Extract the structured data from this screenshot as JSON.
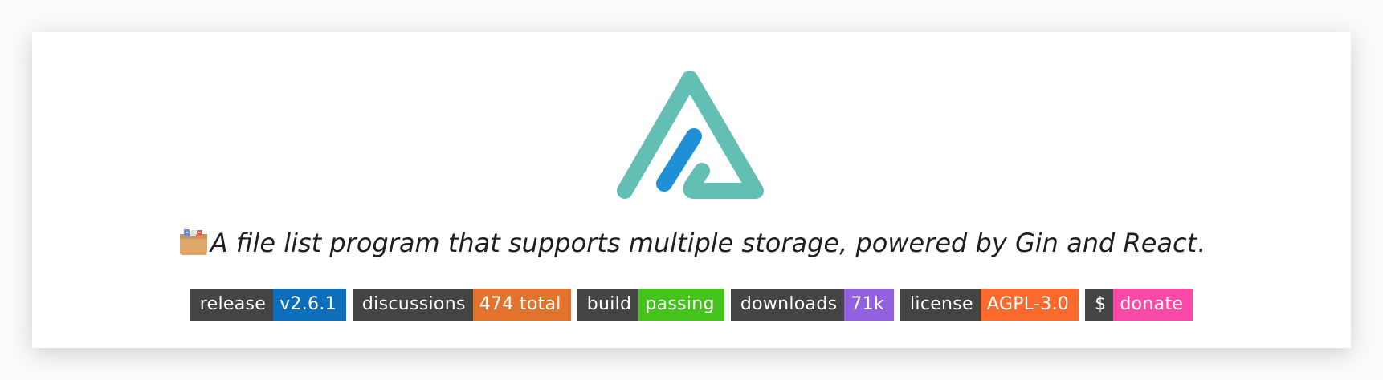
{
  "tagline": {
    "icon": "file-box-icon",
    "text": "A file list program that supports multiple storage, powered by Gin and React",
    "period": "."
  },
  "logo": {
    "icon": "alist-logo-icon",
    "colors": {
      "outer": "#63bfb3",
      "inner": "#1f8fd6"
    }
  },
  "badges": [
    {
      "label": "release",
      "value": "v2.6.1",
      "color": "#0d6ebc"
    },
    {
      "label": "discussions",
      "value": "474 total",
      "color": "#e3732c"
    },
    {
      "label": "build",
      "value": "passing",
      "color": "#44c41a"
    },
    {
      "label": "downloads",
      "value": "71k",
      "color": "#9161e0"
    },
    {
      "label": "license",
      "value": "AGPL-3.0",
      "color": "#fb6a2c"
    },
    {
      "label": "$",
      "value": "donate",
      "color": "#fb49a8"
    }
  ],
  "colors": {
    "badge_label_bg": "#444444",
    "text": "#1f1f1f"
  }
}
